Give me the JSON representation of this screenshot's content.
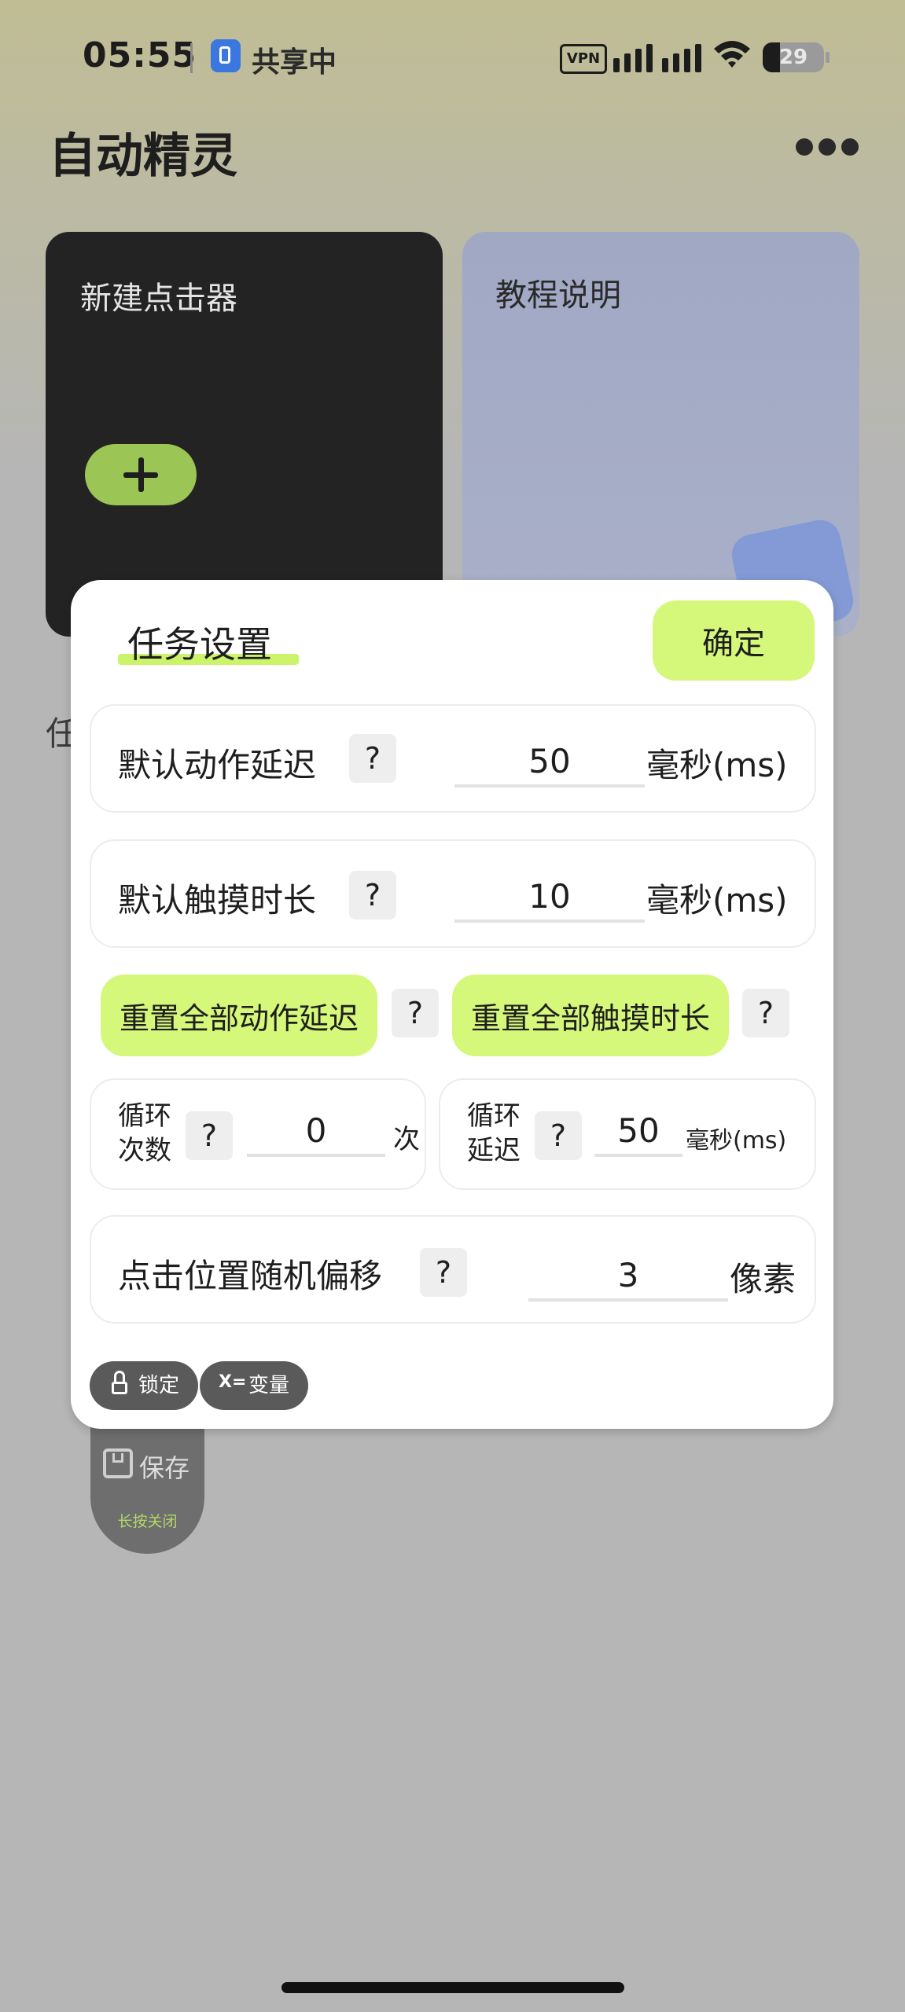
{
  "status_bar": {
    "time": "05:55",
    "share_label": "共享中",
    "vpn_label": "VPN",
    "battery": "29"
  },
  "app": {
    "title": "自动精灵"
  },
  "cards": {
    "new_clicker": "新建点击器",
    "tutorial": "教程说明"
  },
  "behind_text": "任",
  "dialog": {
    "title": "任务设置",
    "confirm_label": "确定",
    "default_action_delay": {
      "label": "默认动作延迟",
      "help": "?",
      "value": "50",
      "unit": "毫秒(ms)"
    },
    "default_touch_duration": {
      "label": "默认触摸时长",
      "help": "?",
      "value": "10",
      "unit": "毫秒(ms)"
    },
    "reset_all_action_delay": "重置全部动作延迟",
    "reset_all_touch_duration": "重置全部触摸时长",
    "reset_help": "?",
    "loop_count": {
      "label_line1": "循环",
      "label_line2": "次数",
      "help": "?",
      "value": "0",
      "unit": "次"
    },
    "loop_delay": {
      "label_line1": "循环",
      "label_line2": "延迟",
      "help": "?",
      "value": "50",
      "unit": "毫秒(ms)"
    },
    "random_offset": {
      "label": "点击位置随机偏移",
      "help": "?",
      "value": "3",
      "unit": "像素"
    },
    "lock_label": "锁定",
    "variable_icon": "X=",
    "variable_label": "变量"
  },
  "save_fab": {
    "label": "保存",
    "hint": "长按关闭"
  },
  "colors": {
    "accent_green": "#d5f77a",
    "dark_card": "#232323",
    "plus_green": "#9bc554"
  }
}
